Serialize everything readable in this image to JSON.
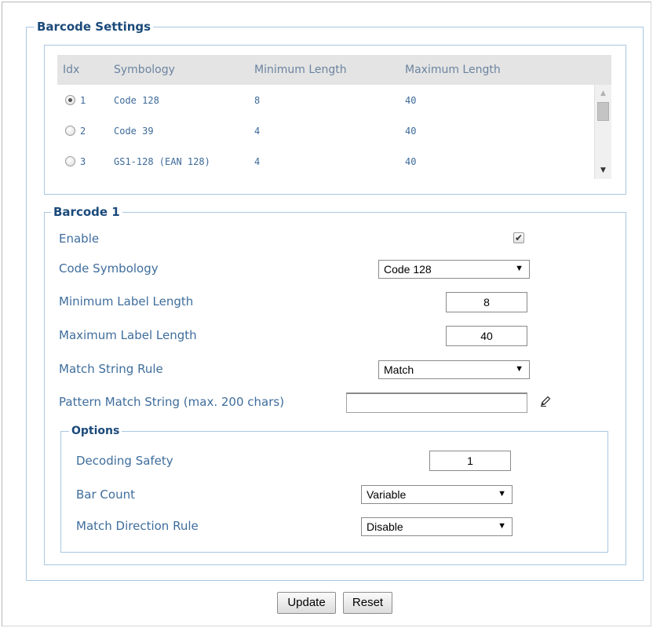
{
  "barcode_settings": {
    "legend": "Barcode Settings",
    "columns": [
      "Idx",
      "Symbology",
      "Minimum Length",
      "Maximum Length"
    ],
    "rows": [
      {
        "idx": "1",
        "symbology": "Code 128",
        "min": "8",
        "max": "40",
        "selected": true
      },
      {
        "idx": "2",
        "symbology": "Code 39",
        "min": "4",
        "max": "40",
        "selected": false
      },
      {
        "idx": "3",
        "symbology": "GS1-128 (EAN 128)",
        "min": "4",
        "max": "40",
        "selected": false
      }
    ]
  },
  "barcode1": {
    "legend": "Barcode 1",
    "enable_label": "Enable",
    "enable_checked": true,
    "symbology_label": "Code Symbology",
    "symbology_value": "Code 128",
    "min_label": "Minimum Label Length",
    "min_value": "8",
    "max_label": "Maximum Label Length",
    "max_value": "40",
    "match_rule_label": "Match String Rule",
    "match_rule_value": "Match",
    "pattern_label": "Pattern Match String (max. 200 chars)",
    "pattern_value": "",
    "options": {
      "legend": "Options",
      "decoding_safety_label": "Decoding Safety",
      "decoding_safety_value": "1",
      "bar_count_label": "Bar Count",
      "bar_count_value": "Variable",
      "match_direction_label": "Match Direction Rule",
      "match_direction_value": "Disable"
    }
  },
  "buttons": {
    "update": "Update",
    "reset": "Reset"
  },
  "icons": {
    "dropdown": "▼",
    "scroll_up": "▲",
    "scroll_down": "▼",
    "check": "✔",
    "edit": "pencil-icon"
  }
}
